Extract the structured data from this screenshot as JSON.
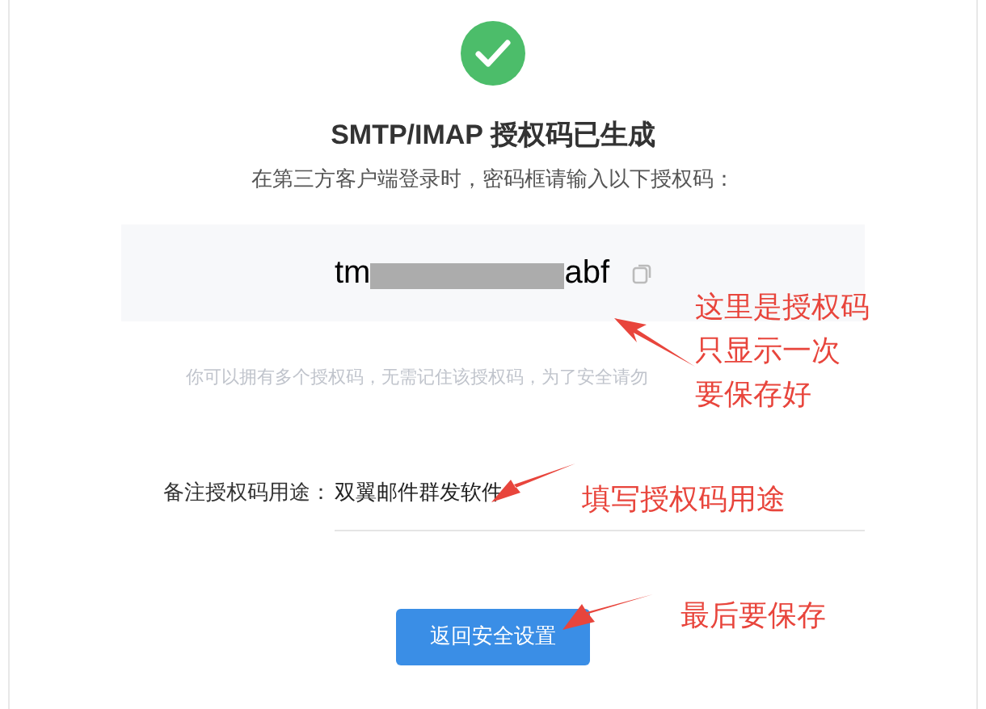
{
  "title": "SMTP/IMAP 授权码已生成",
  "subtitle": "在第三方客户端登录时，密码框请输入以下授权码：",
  "code": {
    "start": "tm",
    "end": "abf",
    "redacted": true
  },
  "hint": "你可以拥有多个授权码，无需记住该授权码，为了安全请勿",
  "note": {
    "label": "备注授权码用途：",
    "value": "双翼邮件群发软件"
  },
  "button": "返回安全设置",
  "annotations": [
    {
      "lines": [
        "这里是授权码",
        "只显示一次",
        "要保存好"
      ]
    },
    {
      "lines": [
        "填写授权码用途"
      ]
    },
    {
      "lines": [
        "最后要保存"
      ]
    }
  ]
}
